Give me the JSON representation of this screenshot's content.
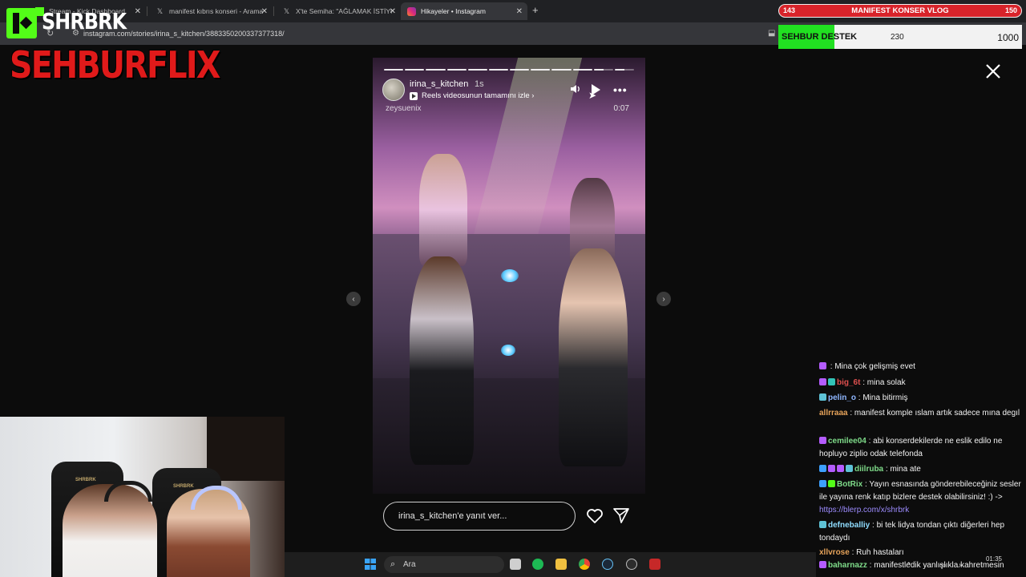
{
  "browser": {
    "tabs": [
      {
        "title": "Stream - Kick Dashboard",
        "icon": "kick-icon",
        "active": false
      },
      {
        "title": "manifest kıbrıs konseri - Arama",
        "icon": "x-icon",
        "active": false
      },
      {
        "title": "X'te Semiha: \"AĞLAMAK İSTİYO",
        "icon": "x-icon",
        "active": false
      },
      {
        "title": "Hikayeler • Instagram",
        "icon": "instagram-icon",
        "active": true
      }
    ],
    "new_tab": "+",
    "url": "instagram.com/stories/irina_s_kitchen/3883350200337377318/"
  },
  "overlay": {
    "brand": "SHRBRK",
    "flix": "SEHBURFLIX",
    "vlog": {
      "left": "143",
      "title": "MANIFEST KONSER VLOG",
      "right": "150"
    },
    "support": {
      "label": "SEHBUR DESTEK",
      "current": "230",
      "goal": "1000",
      "progress": 0.23
    }
  },
  "story": {
    "username": "irina_s_kitchen",
    "time": "1s",
    "reels_link": "Reels videosunun tamamını izle",
    "handle": "zeysuenix",
    "clock": "0:07",
    "reply_placeholder": "irina_s_kitchen'e yanıt ver...",
    "segments": 12,
    "active_segment": 11
  },
  "chat": [
    {
      "user": "",
      "text": "Mina çok gelişmiş evet",
      "color": "#9acd32",
      "badges": [
        "#b45cff"
      ]
    },
    {
      "user": "big_6t",
      "text": "mina solak",
      "color": "#e0504f",
      "badges": [
        "#b45cff",
        "#33c3b7"
      ]
    },
    {
      "user": "pelin_o",
      "text": "Mina bitirmiş",
      "color": "#8fb7ff",
      "badges": [
        "#5ec2d6"
      ]
    },
    {
      "user": "allrraaa",
      "text": "manifest komple ıslam artık sadece mına degıl",
      "color": "#e6a35a",
      "badges": []
    },
    {
      "user": "cemilee04",
      "text": "abi konserdekilerde ne eslik edilo ne hopluyo ziplio odak telefonda",
      "color": "#7fdc8a",
      "badges": [
        "#b45cff"
      ]
    },
    {
      "user": "diilruba",
      "text": "mina ate",
      "color": "#7fdc8a",
      "badges": [
        "#3da0ff",
        "#b45cff",
        "#b45cff",
        "#5ec2d6"
      ]
    },
    {
      "user": "BotRix",
      "text": "Yayın esnasında gönderebileceğiniz sesler ile yayına renk katıp bizlere destek olabilirsiniz! :) -> ",
      "link": "https://blerp.com/x/shrbrk",
      "color": "#7fdc8a",
      "badges": [
        "#3da0ff",
        "#53fc18"
      ]
    },
    {
      "user": "defneballiy",
      "text": "bi tek lidya tondan çıktı diğerleri hep tondaydı",
      "color": "#8fdcff",
      "badges": [
        "#5ec2d6"
      ]
    },
    {
      "user": "xllvrose",
      "text": "Ruh hastaları",
      "color": "#e6a35a",
      "badges": []
    },
    {
      "user": "baharnazz",
      "text": "manifestledik yanlışlıkla kahretmesin",
      "color": "#7fdc8a",
      "badges": [
        "#b45cff"
      ]
    }
  ],
  "taskbar": {
    "search_label": "Ara",
    "apps": [
      "file-icon",
      "spotify-icon",
      "folder-icon",
      "chrome-icon",
      "steam-icon",
      "app-icon",
      "news-icon"
    ],
    "time": "01:35",
    "date": ""
  }
}
